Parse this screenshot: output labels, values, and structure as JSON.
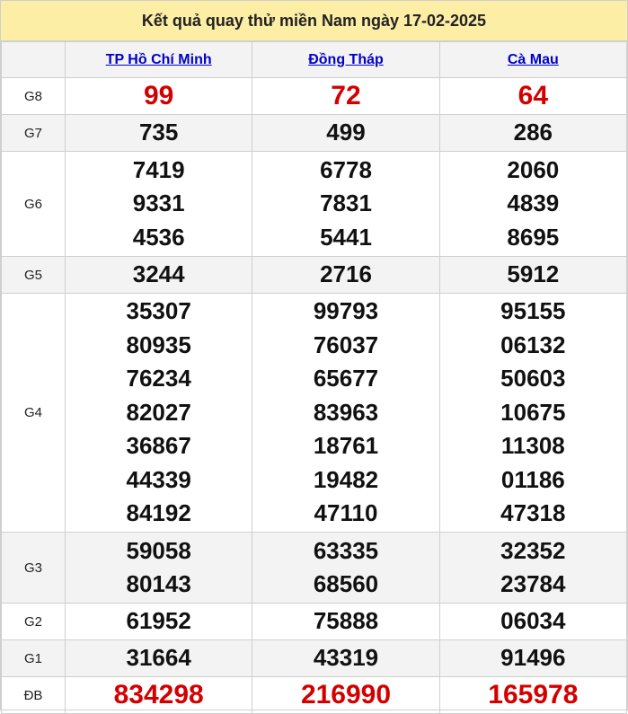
{
  "title": "Kết quả quay thử miền Nam ngày 17-02-2025",
  "provinces": [
    "TP Hồ Chí Minh",
    "Đồng Tháp",
    "Cà Mau"
  ],
  "prizes": [
    {
      "label": "G8",
      "values": [
        [
          "99"
        ],
        [
          "72"
        ],
        [
          "64"
        ]
      ]
    },
    {
      "label": "G7",
      "values": [
        [
          "735"
        ],
        [
          "499"
        ],
        [
          "286"
        ]
      ]
    },
    {
      "label": "G6",
      "values": [
        [
          "7419",
          "9331",
          "4536"
        ],
        [
          "6778",
          "7831",
          "5441"
        ],
        [
          "2060",
          "4839",
          "8695"
        ]
      ]
    },
    {
      "label": "G5",
      "values": [
        [
          "3244"
        ],
        [
          "2716"
        ],
        [
          "5912"
        ]
      ]
    },
    {
      "label": "G4",
      "values": [
        [
          "35307",
          "80935",
          "76234",
          "82027",
          "36867",
          "44339",
          "84192"
        ],
        [
          "99793",
          "76037",
          "65677",
          "83963",
          "18761",
          "19482",
          "47110"
        ],
        [
          "95155",
          "06132",
          "50603",
          "10675",
          "11308",
          "01186",
          "47318"
        ]
      ]
    },
    {
      "label": "G3",
      "values": [
        [
          "59058",
          "80143"
        ],
        [
          "63335",
          "68560"
        ],
        [
          "32352",
          "23784"
        ]
      ]
    },
    {
      "label": "G2",
      "values": [
        [
          "61952"
        ],
        [
          "75888"
        ],
        [
          "06034"
        ]
      ]
    },
    {
      "label": "G1",
      "values": [
        [
          "31664"
        ],
        [
          "43319"
        ],
        [
          "91496"
        ]
      ]
    },
    {
      "label": "ĐB",
      "values": [
        [
          "834298"
        ],
        [
          "216990"
        ],
        [
          "165978"
        ]
      ]
    }
  ],
  "colors": {
    "header_bg": "#fdeea5",
    "highlight": "#d40000",
    "link": "#0000cc",
    "alt_row": "#f3f3f3"
  }
}
